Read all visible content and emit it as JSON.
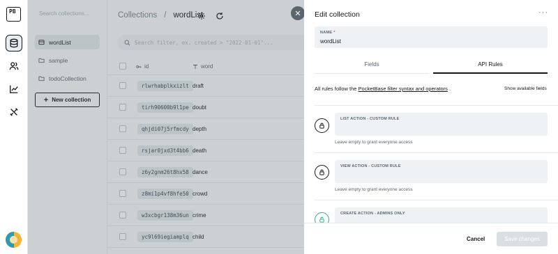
{
  "rail": {
    "logo_text": "PB",
    "icons": [
      "database-icon",
      "users-icon",
      "chart-icon",
      "tools-icon"
    ]
  },
  "sidebar": {
    "search_placeholder": "Search collections...",
    "items": [
      {
        "label": "wordList",
        "active": true
      },
      {
        "label": "sample",
        "active": false
      },
      {
        "label": "todoCollection",
        "active": false
      }
    ],
    "new_collection_label": "New collection"
  },
  "main": {
    "breadcrumb_root": "Collections",
    "breadcrumb_sep": "/",
    "breadcrumb_current": "wordList",
    "search_placeholder": "Search filter, ex. created > \"2022-01-01\"...",
    "columns": {
      "id": "id",
      "word": "word"
    },
    "rows": [
      {
        "id": "rlwrhabplkxizlt",
        "word": "draft"
      },
      {
        "id": "tirh90600b9l1pe",
        "word": "doubt"
      },
      {
        "id": "qhjdi07j5rfmcdy",
        "word": "depth"
      },
      {
        "id": "rsjar0jxd3t4bb6",
        "word": "death"
      },
      {
        "id": "z6y2gnm26t8hx58",
        "word": "dance"
      },
      {
        "id": "z8mi1p4vf8hfe50",
        "word": "crowd"
      },
      {
        "id": "w3xcbgr138m36un",
        "word": "crime"
      },
      {
        "id": "yc9l69iegiamplq",
        "word": "child"
      }
    ]
  },
  "panel": {
    "title": "Edit collection",
    "menu": "···",
    "close": "✕",
    "name_label": "NAME",
    "name_required": "*",
    "name_value": "wordList",
    "tabs": [
      "Fields",
      "API Rules"
    ],
    "rules_note_prefix": "All rules follow the ",
    "rules_note_link": "PocketBase filter syntax and operators",
    "rules_note_suffix": " .",
    "show_fields": "Show available fields",
    "rules": [
      {
        "label": "LIST ACTION - CUSTOM RULE",
        "hint": "Leave empty to grant everyone access"
      },
      {
        "label": "VIEW ACTION - CUSTOM RULE",
        "hint": "Leave empty to grant everyone access"
      },
      {
        "label": "CREATE ACTION - ADMINS ONLY",
        "hint": ""
      }
    ],
    "cancel_label": "Cancel",
    "save_label": "Save changes"
  },
  "colors": {
    "accent": "#16161a",
    "required": "#e34562",
    "admins_only": "#32ad84"
  }
}
